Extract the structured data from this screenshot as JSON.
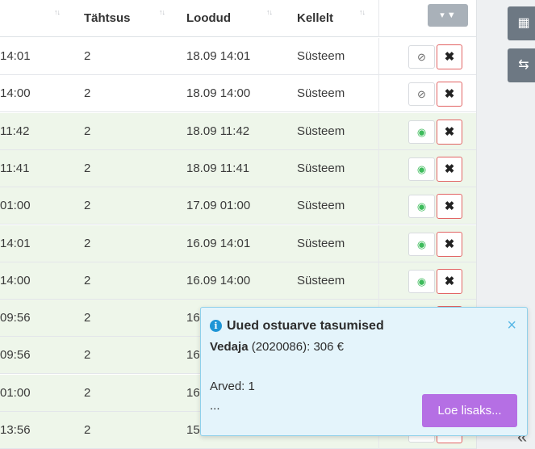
{
  "header": {
    "columns": {
      "priority": "Tähtsus",
      "created": "Loodud",
      "from": "Kellelt"
    }
  },
  "rows": [
    {
      "time": "14:01",
      "priority": "2",
      "created": "18.09 14:01",
      "from": "Süsteem",
      "read": false,
      "bg": "#ffffff"
    },
    {
      "time": "14:00",
      "priority": "2",
      "created": "18.09 14:00",
      "from": "Süsteem",
      "read": false,
      "bg": "#ffffff"
    },
    {
      "time": "11:42",
      "priority": "2",
      "created": "18.09 11:42",
      "from": "Süsteem",
      "read": true,
      "bg": "#eef6ea"
    },
    {
      "time": "11:41",
      "priority": "2",
      "created": "18.09 11:41",
      "from": "Süsteem",
      "read": true,
      "bg": "#eef6ea"
    },
    {
      "time": "01:00",
      "priority": "2",
      "created": "17.09 01:00",
      "from": "Süsteem",
      "read": true,
      "bg": "#eef6ea"
    },
    {
      "time": "14:01",
      "priority": "2",
      "created": "16.09 14:01",
      "from": "Süsteem",
      "read": true,
      "bg": "#eef6ea"
    },
    {
      "time": "14:00",
      "priority": "2",
      "created": "16.09 14:00",
      "from": "Süsteem",
      "read": true,
      "bg": "#eef6ea"
    },
    {
      "time": "09:56",
      "priority": "2",
      "created": "16",
      "from": "",
      "read": true,
      "bg": "#eef6ea"
    },
    {
      "time": "09:56",
      "priority": "2",
      "created": "16",
      "from": "",
      "read": true,
      "bg": "#eef6ea"
    },
    {
      "time": "01:00",
      "priority": "2",
      "created": "16",
      "from": "",
      "read": true,
      "bg": "#eef6ea"
    },
    {
      "time": "13:56",
      "priority": "2",
      "created": "15",
      "from": "",
      "read": true,
      "bg": "#eef6ea"
    }
  ],
  "toast": {
    "title": "Uued ostuarve tasumised",
    "vendor_name": "Vedaja",
    "vendor_detail": "(2020086): 306 €",
    "invoices": "Arved: 1",
    "ellipsis": "...",
    "more_label": "Loe lisaks...",
    "close": "×",
    "info_icon": "i"
  },
  "icons": {
    "filter": "filter-icon",
    "eye_on": "eye-icon",
    "eye_off": "eye-slash-icon",
    "delete": "close-icon",
    "collapse": "double-chevron-left-icon"
  },
  "colors": {
    "read_row": "#eef6ea",
    "accent_purple": "#b56fe4",
    "info_blue": "#1e95d6",
    "delete_border": "#e26464",
    "eye_green": "#3dbb5b"
  }
}
